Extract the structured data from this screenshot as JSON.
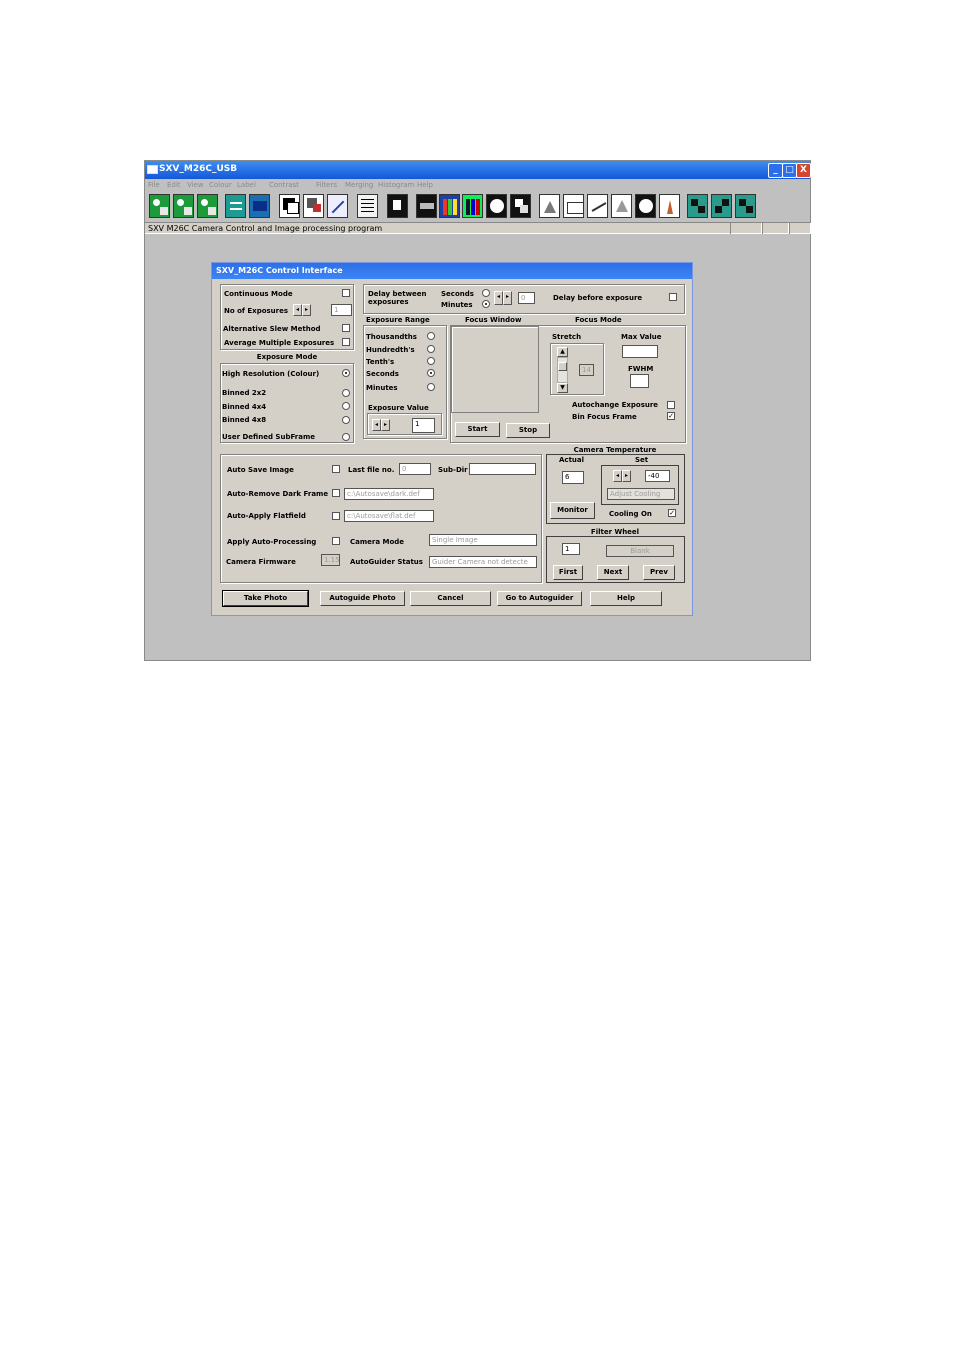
{
  "app": {
    "title": "SXV_M26C_USB",
    "menu": [
      "File",
      "Edit",
      "View",
      "Colour",
      "Label",
      "Contrast",
      "Filters",
      "Merging",
      "Histogram",
      "Help"
    ],
    "window_buttons": {
      "minimize": "_",
      "maximize": "□",
      "close": "X"
    },
    "status_text": "SXV M26C Camera Control and Image processing program"
  },
  "dialog": {
    "title": "SXV_M26C Control Interface",
    "continuous_mode": "Continuous Mode",
    "no_of_exposures": "No of Exposures",
    "no_of_exposures_value": "1",
    "alternative_slew": "Alternative Slew Method",
    "average_multiple": "Average Multiple Exposures",
    "exposure_mode_title": "Exposure Mode",
    "exposure_modes": [
      "High Resolution (Colour)",
      "Binned 2x2",
      "Binned 4x4",
      "Binned 4x8",
      "User Defined SubFrame"
    ],
    "delay_between": "Delay between exposures",
    "seconds": "Seconds",
    "minutes": "Minutes",
    "delay_value": "0",
    "delay_before": "Delay before exposure",
    "exposure_range_title": "Exposure Range",
    "exposure_ranges": [
      "Thousandths",
      "Hundredth's",
      "Tenth's",
      "Seconds",
      "Minutes"
    ],
    "exposure_value_title": "Exposure Value",
    "exposure_value": "1",
    "focus_window_title": "Focus Window",
    "start": "Start",
    "stop": "Stop",
    "focus_mode_title": "Focus Mode",
    "stretch": "Stretch",
    "stretch_value": "14",
    "max_value": "Max Value",
    "fwhm": "FWHM",
    "autochange_exposure": "Autochange Exposure",
    "bin_focus_frame": "Bin Focus Frame",
    "auto_save": "Auto Save Image",
    "last_file_no": "Last file no.",
    "last_file_value": "0",
    "sub_dir": "Sub-Dir",
    "auto_remove_dark": "Auto-Remove Dark Frame",
    "dark_path": "c:\\Autosave\\dark.def",
    "auto_apply_flat": "Auto-Apply Flatfield",
    "flat_path": "c:\\Autosave\\flat.def",
    "apply_auto_processing": "Apply Auto-Processing",
    "camera_mode": "Camera Mode",
    "camera_mode_value": "Single Image",
    "camera_firmware": "Camera Firmware",
    "firmware_value": "1.15",
    "autoguider_status": "AutoGuider Status",
    "autoguider_status_value": "Guider Camera not detecte",
    "camera_temperature_title": "Camera Temperature",
    "actual": "Actual",
    "actual_value": "6",
    "set": "Set",
    "set_value": "-40",
    "adjust_cooling": "Adjust Cooling",
    "monitor": "Monitor",
    "cooling_on": "Cooling On",
    "filter_wheel_title": "Filter Wheel",
    "filter_number": "1",
    "filter_name": "Blank",
    "first": "First",
    "next": "Next",
    "prev": "Prev",
    "buttons": {
      "take_photo": "Take Photo",
      "autoguide_photo": "Autoguide Photo",
      "cancel": "Cancel",
      "go_to_autoguider": "Go to Autoguider",
      "help": "Help"
    }
  }
}
